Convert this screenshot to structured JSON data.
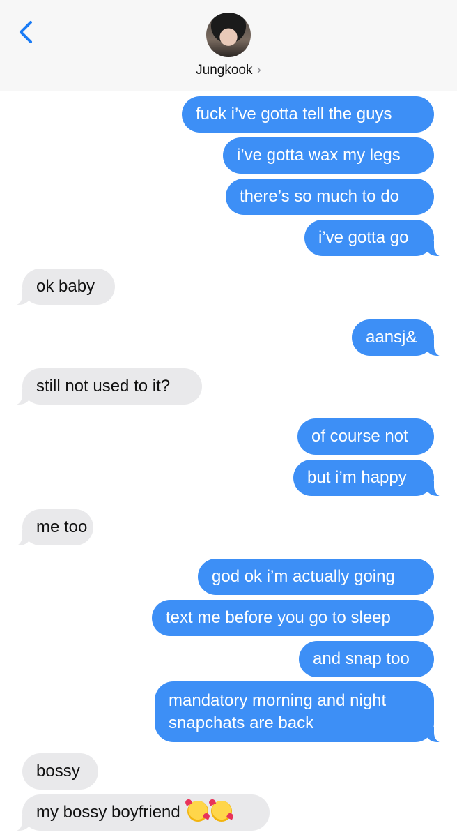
{
  "header": {
    "contact_name": "Jungkook",
    "chevron": "›"
  },
  "messages": [
    {
      "dir": "sent",
      "text": "fuck i’ve gotta tell the guys"
    },
    {
      "dir": "sent",
      "text": "i’ve gotta wax my legs"
    },
    {
      "dir": "sent",
      "text": "there’s so much to do"
    },
    {
      "dir": "sent",
      "text": "i’ve gotta go"
    },
    {
      "dir": "recv",
      "text": "ok baby"
    },
    {
      "dir": "sent",
      "text": "aansj&"
    },
    {
      "dir": "recv",
      "text": "still not used to it?"
    },
    {
      "dir": "sent",
      "text": "of course not"
    },
    {
      "dir": "sent",
      "text": "but i’m happy"
    },
    {
      "dir": "recv",
      "text": "me too"
    },
    {
      "dir": "sent",
      "text": "god ok i’m actually going"
    },
    {
      "dir": "sent",
      "text": "text me before you go to sleep"
    },
    {
      "dir": "sent",
      "text": "and snap too"
    },
    {
      "dir": "sent",
      "text": "mandatory morning and night snapchats are back"
    },
    {
      "dir": "recv",
      "text": "bossy"
    },
    {
      "dir": "recv",
      "text": "my bossy boyfriend",
      "emoji": [
        "smiling-face-with-hearts",
        "smiling-face-with-hearts"
      ]
    }
  ],
  "colors": {
    "sent_bubble": "#3d8ff6",
    "received_bubble": "#e9e9eb",
    "accent": "#1a7bf5"
  },
  "icons": {
    "back": "chevron-left-icon",
    "avatar": "contact-avatar"
  }
}
